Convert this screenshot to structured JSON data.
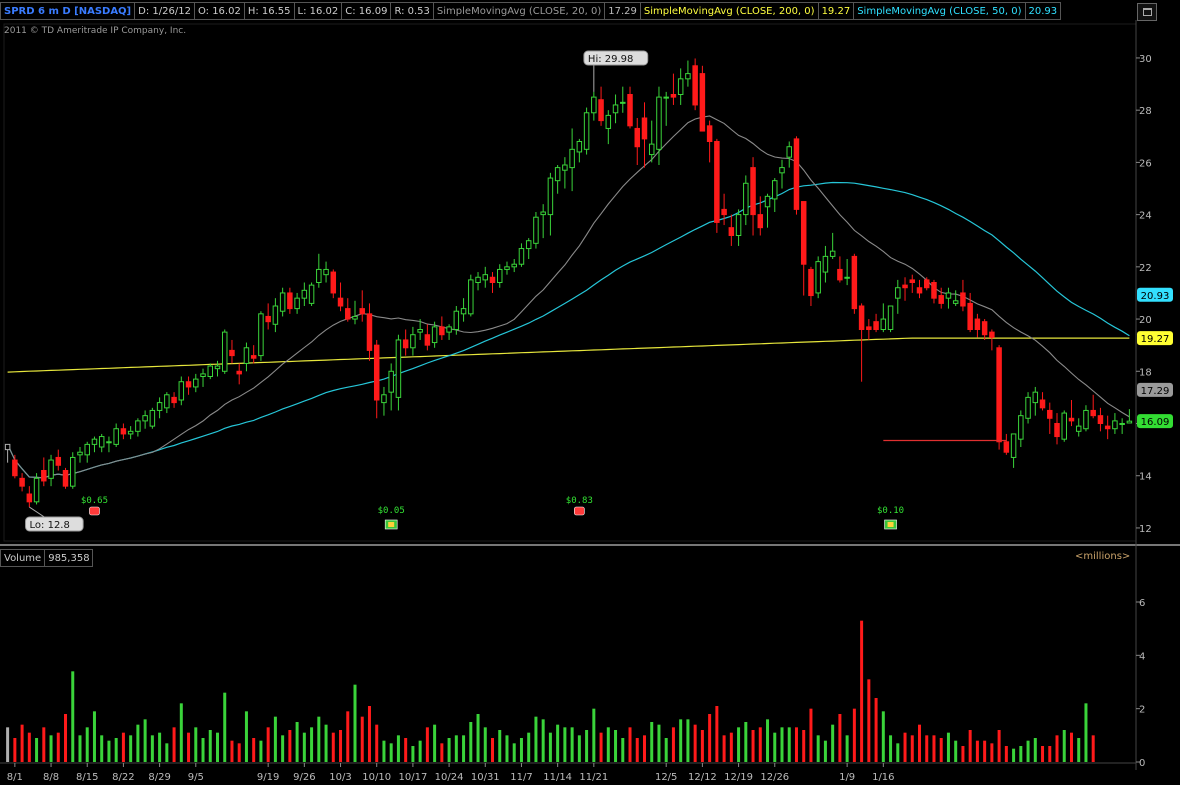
{
  "header": {
    "symbol": "SPRD 6 m D [NASDAQ]",
    "date": "D: 1/26/12",
    "open": "O: 16.02",
    "high": "H: 16.55",
    "low": "L: 16.02",
    "close": "C: 16.09",
    "range": "R: 0.53",
    "sma20_label": "SimpleMovingAvg (CLOSE, 20, 0)",
    "sma20_value": "17.29",
    "sma200_label": "SimpleMovingAvg (CLOSE, 200, 0)",
    "sma200_value": "19.27",
    "sma50_label": "SimpleMovingAvg (CLOSE, 50, 0)",
    "sma50_value": "20.93"
  },
  "copyright": "2011 © TD Ameritrade IP Company, Inc.",
  "volume_panel": {
    "label": "Volume",
    "value": "985,358",
    "unit": "<millions>"
  },
  "colors": {
    "up": "#3ad43a",
    "down": "#ff1a1a",
    "sma20": "#8a8a8a",
    "sma50": "#26c6d8",
    "sma200": "#e6e63c",
    "grid": "#2a2a2a",
    "axis_text": "#bbbbbb",
    "flat": "#b0b0b0"
  },
  "chart_data": [
    {
      "type": "candlestick",
      "title": "SPRD 6 m D [NASDAQ]",
      "ylim": [
        11.5,
        31.3
      ],
      "y_ticks": [
        "12",
        "14",
        "16",
        "18",
        "20",
        "22",
        "24",
        "26",
        "28",
        "30"
      ],
      "x_tick_labels": [
        "8/1",
        "8/8",
        "8/15",
        "8/22",
        "8/29",
        "9/5",
        "9/19",
        "9/26",
        "10/3",
        "10/10",
        "10/17",
        "10/24",
        "10/31",
        "11/7",
        "11/14",
        "11/21",
        "12/5",
        "12/12",
        "12/19",
        "12/26",
        "1/9",
        "1/16"
      ],
      "x_tick_positions": [
        1,
        6,
        11,
        16,
        21,
        26,
        36,
        41,
        46,
        51,
        56,
        61,
        66,
        71,
        76,
        81,
        91,
        96,
        101,
        106,
        116,
        121
      ],
      "hi_label": "Hi: 29.98",
      "lo_label": "Lo: 12.8",
      "hi_index": 81,
      "lo_index": 3,
      "sma_value_labels": {
        "sma50": "20.93",
        "sma200": "19.27",
        "sma20": "17.29",
        "last": "16.09"
      },
      "candles": [
        [
          15.0,
          15.2,
          14.5,
          15.2
        ],
        [
          14.6,
          14.8,
          13.9,
          14.0
        ],
        [
          13.9,
          14.1,
          13.4,
          13.6
        ],
        [
          13.3,
          13.6,
          12.8,
          13.0
        ],
        [
          13.0,
          14.1,
          12.9,
          13.9
        ],
        [
          14.2,
          14.7,
          13.6,
          13.8
        ],
        [
          13.9,
          14.8,
          13.6,
          14.6
        ],
        [
          14.7,
          15.0,
          14.2,
          14.4
        ],
        [
          14.2,
          14.3,
          13.5,
          13.6
        ],
        [
          13.6,
          14.9,
          13.5,
          14.7
        ],
        [
          14.8,
          15.1,
          14.5,
          14.9
        ],
        [
          14.8,
          15.3,
          14.5,
          15.2
        ],
        [
          15.2,
          15.5,
          14.9,
          15.4
        ],
        [
          15.1,
          15.6,
          14.9,
          15.5
        ],
        [
          15.3,
          15.5,
          14.9,
          15.3
        ],
        [
          15.2,
          16.0,
          15.1,
          15.8
        ],
        [
          15.8,
          16.0,
          15.4,
          15.6
        ],
        [
          15.6,
          15.9,
          15.4,
          15.7
        ],
        [
          15.7,
          16.2,
          15.5,
          16.1
        ],
        [
          16.1,
          16.5,
          15.8,
          16.3
        ],
        [
          15.9,
          16.6,
          15.8,
          16.5
        ],
        [
          16.5,
          17.0,
          16.2,
          16.8
        ],
        [
          16.6,
          17.2,
          16.4,
          17.1
        ],
        [
          17.0,
          17.2,
          16.6,
          16.8
        ],
        [
          16.9,
          17.8,
          16.7,
          17.6
        ],
        [
          17.6,
          17.8,
          17.1,
          17.4
        ],
        [
          17.4,
          17.9,
          17.2,
          17.7
        ],
        [
          17.8,
          18.1,
          17.4,
          17.9
        ],
        [
          17.8,
          18.3,
          17.7,
          18.2
        ],
        [
          18.1,
          18.4,
          17.8,
          18.2
        ],
        [
          18.0,
          19.6,
          17.9,
          19.5
        ],
        [
          18.8,
          19.2,
          18.3,
          18.6
        ],
        [
          18.0,
          18.3,
          17.5,
          17.9
        ],
        [
          18.3,
          19.1,
          18.0,
          18.9
        ],
        [
          18.6,
          19.0,
          18.3,
          18.5
        ],
        [
          18.6,
          20.3,
          18.4,
          20.2
        ],
        [
          20.1,
          20.6,
          19.6,
          19.9
        ],
        [
          19.8,
          20.8,
          19.5,
          20.5
        ],
        [
          20.3,
          21.2,
          20.1,
          21.0
        ],
        [
          21.0,
          21.2,
          20.2,
          20.4
        ],
        [
          20.4,
          21.0,
          20.2,
          20.8
        ],
        [
          20.8,
          21.4,
          20.5,
          21.1
        ],
        [
          20.6,
          21.4,
          20.5,
          21.3
        ],
        [
          21.4,
          22.5,
          21.2,
          21.9
        ],
        [
          21.7,
          22.2,
          21.4,
          21.9
        ],
        [
          21.8,
          21.9,
          20.8,
          21.0
        ],
        [
          20.8,
          21.4,
          20.3,
          20.5
        ],
        [
          20.4,
          20.8,
          19.9,
          20.0
        ],
        [
          20.0,
          20.7,
          19.8,
          20.1
        ],
        [
          20.4,
          21.1,
          19.9,
          20.2
        ],
        [
          20.2,
          20.6,
          18.4,
          18.8
        ],
        [
          19.0,
          19.2,
          16.2,
          16.9
        ],
        [
          16.8,
          17.4,
          16.3,
          17.1
        ],
        [
          17.2,
          18.3,
          16.5,
          18.0
        ],
        [
          17.0,
          19.4,
          16.5,
          19.2
        ],
        [
          19.2,
          19.6,
          18.6,
          18.9
        ],
        [
          18.9,
          19.7,
          18.6,
          19.4
        ],
        [
          19.5,
          20.0,
          19.2,
          19.6
        ],
        [
          19.4,
          19.8,
          18.8,
          19.0
        ],
        [
          19.1,
          19.9,
          18.9,
          19.7
        ],
        [
          19.7,
          20.1,
          19.2,
          19.4
        ],
        [
          19.5,
          19.8,
          19.2,
          19.7
        ],
        [
          19.6,
          20.5,
          19.4,
          20.3
        ],
        [
          20.2,
          20.8,
          19.9,
          20.4
        ],
        [
          20.2,
          21.7,
          20.1,
          21.5
        ],
        [
          21.4,
          21.8,
          21.1,
          21.6
        ],
        [
          21.5,
          22.0,
          21.2,
          21.7
        ],
        [
          21.6,
          21.8,
          21.0,
          21.4
        ],
        [
          21.4,
          22.1,
          21.2,
          21.9
        ],
        [
          21.9,
          22.2,
          21.7,
          22.0
        ],
        [
          22.0,
          22.3,
          21.8,
          22.1
        ],
        [
          22.1,
          22.9,
          22.0,
          22.7
        ],
        [
          22.7,
          23.1,
          22.3,
          23.0
        ],
        [
          22.9,
          24.1,
          22.7,
          23.9
        ],
        [
          24.0,
          24.4,
          23.1,
          24.1
        ],
        [
          24.0,
          25.6,
          23.2,
          25.4
        ],
        [
          25.3,
          25.9,
          24.8,
          25.8
        ],
        [
          25.7,
          26.2,
          25.0,
          25.9
        ],
        [
          25.8,
          27.3,
          24.9,
          26.5
        ],
        [
          26.4,
          26.9,
          26.0,
          26.8
        ],
        [
          26.5,
          28.1,
          26.3,
          27.9
        ],
        [
          27.9,
          28.7,
          27.6,
          28.5
        ],
        [
          28.4,
          28.9,
          27.4,
          27.6
        ],
        [
          27.3,
          28.0,
          26.7,
          27.8
        ],
        [
          27.9,
          28.6,
          27.5,
          28.2
        ],
        [
          28.3,
          28.9,
          27.9,
          28.3
        ],
        [
          28.6,
          28.9,
          27.3,
          27.4
        ],
        [
          27.3,
          27.7,
          25.9,
          26.6
        ],
        [
          27.7,
          28.3,
          25.8,
          26.9
        ],
        [
          26.3,
          27.6,
          26.0,
          26.7
        ],
        [
          26.5,
          28.9,
          25.9,
          28.5
        ],
        [
          28.5,
          28.7,
          27.4,
          28.5
        ],
        [
          28.6,
          29.4,
          28.2,
          28.5
        ],
        [
          28.6,
          29.6,
          28.2,
          29.2
        ],
        [
          29.2,
          29.9,
          28.9,
          29.4
        ],
        [
          29.7,
          29.98,
          28.0,
          28.2
        ],
        [
          29.4,
          29.7,
          28.1,
          27.2
        ],
        [
          27.4,
          27.6,
          26.0,
          26.8
        ],
        [
          26.8,
          26.9,
          23.3,
          23.7
        ],
        [
          24.2,
          24.8,
          23.6,
          24.0
        ],
        [
          23.5,
          24.0,
          22.8,
          23.2
        ],
        [
          23.2,
          24.2,
          22.8,
          24.0
        ],
        [
          24.0,
          25.5,
          23.6,
          25.2
        ],
        [
          25.8,
          26.2,
          23.2,
          24.0
        ],
        [
          24.0,
          24.7,
          23.2,
          23.5
        ],
        [
          24.3,
          24.8,
          23.5,
          24.7
        ],
        [
          24.6,
          25.4,
          24.1,
          25.3
        ],
        [
          25.6,
          26.1,
          25.0,
          25.8
        ],
        [
          26.2,
          26.8,
          25.8,
          26.6
        ],
        [
          26.9,
          27.0,
          24.0,
          24.2
        ],
        [
          24.5,
          24.5,
          20.9,
          22.1
        ],
        [
          21.9,
          22.0,
          20.5,
          20.9
        ],
        [
          21.0,
          22.4,
          20.8,
          22.2
        ],
        [
          21.8,
          22.8,
          21.4,
          22.4
        ],
        [
          22.4,
          23.3,
          22.3,
          22.6
        ],
        [
          21.9,
          22.4,
          21.4,
          21.5
        ],
        [
          21.6,
          22.3,
          21.3,
          21.6
        ],
        [
          22.4,
          22.5,
          20.2,
          20.4
        ],
        [
          20.5,
          20.6,
          17.6,
          19.6
        ],
        [
          19.7,
          20.0,
          19.2,
          19.6
        ],
        [
          19.9,
          20.2,
          19.5,
          19.6
        ],
        [
          19.6,
          20.6,
          19.5,
          20.0
        ],
        [
          19.6,
          20.5,
          19.5,
          20.5
        ],
        [
          20.8,
          21.5,
          20.2,
          21.2
        ],
        [
          21.3,
          21.6,
          20.7,
          21.2
        ],
        [
          21.5,
          21.7,
          21.0,
          21.4
        ],
        [
          21.2,
          21.5,
          20.8,
          21.0
        ],
        [
          21.5,
          21.6,
          21.1,
          21.2
        ],
        [
          21.4,
          21.5,
          20.6,
          20.8
        ],
        [
          20.9,
          21.2,
          20.4,
          20.6
        ],
        [
          20.8,
          21.2,
          20.4,
          21.0
        ],
        [
          20.6,
          21.1,
          20.5,
          20.7
        ],
        [
          21.0,
          21.5,
          20.3,
          20.5
        ],
        [
          20.6,
          21.0,
          19.5,
          19.6
        ],
        [
          20.0,
          20.2,
          19.3,
          19.6
        ],
        [
          19.9,
          20.0,
          19.2,
          19.4
        ],
        [
          19.5,
          19.6,
          18.8,
          19.3
        ],
        [
          18.9,
          19.0,
          15.0,
          15.3
        ],
        [
          15.3,
          15.6,
          14.8,
          14.9
        ],
        [
          14.7,
          15.6,
          14.3,
          15.6
        ],
        [
          15.4,
          16.5,
          15.1,
          16.3
        ],
        [
          16.2,
          17.2,
          16.0,
          17.0
        ],
        [
          16.8,
          17.4,
          16.3,
          17.2
        ],
        [
          16.9,
          17.2,
          16.5,
          16.6
        ],
        [
          16.5,
          16.8,
          15.6,
          16.2
        ],
        [
          16.0,
          16.4,
          15.2,
          15.5
        ],
        [
          15.4,
          16.5,
          15.3,
          16.4
        ],
        [
          16.2,
          16.9,
          15.9,
          16.1
        ],
        [
          15.7,
          16.2,
          15.5,
          15.9
        ],
        [
          15.8,
          16.7,
          15.7,
          16.5
        ],
        [
          16.5,
          17.1,
          16.2,
          16.3
        ],
        [
          16.3,
          16.6,
          15.7,
          16.0
        ],
        [
          15.9,
          16.3,
          15.4,
          15.8
        ],
        [
          15.8,
          16.4,
          15.6,
          16.1
        ],
        [
          16.0,
          16.2,
          15.6,
          16.0
        ],
        [
          16.02,
          16.55,
          16.02,
          16.09
        ]
      ],
      "dividends": [
        {
          "label": "$0.65",
          "index": 12,
          "icon": "phone-icon"
        },
        {
          "label": "$0.05",
          "index": 53,
          "icon": "dividend-icon"
        },
        {
          "label": "$0.83",
          "index": 79,
          "icon": "phone-icon"
        },
        {
          "label": "$0.10",
          "index": 122,
          "icon": "dividend-icon"
        }
      ],
      "support_line": {
        "value": 15.35,
        "from_index": 121,
        "to_index": 138
      }
    },
    {
      "type": "bar",
      "title": "Volume",
      "ylabel": "millions",
      "ylim": [
        0,
        7.2
      ],
      "y_ticks": [
        "0",
        "2",
        "4",
        "6"
      ],
      "values": [
        1.3,
        0.9,
        1.4,
        1.1,
        0.9,
        1.3,
        1.0,
        1.1,
        1.8,
        3.4,
        1.0,
        1.3,
        1.9,
        1.0,
        0.8,
        0.9,
        1.1,
        1.0,
        1.4,
        1.6,
        1.0,
        1.1,
        0.7,
        1.3,
        2.2,
        1.1,
        1.3,
        0.9,
        1.2,
        1.1,
        2.6,
        0.8,
        0.7,
        1.9,
        0.9,
        0.8,
        1.3,
        1.7,
        1.0,
        1.2,
        1.5,
        1.1,
        1.3,
        1.7,
        1.4,
        1.1,
        1.2,
        1.9,
        2.9,
        1.7,
        2.1,
        1.4,
        0.8,
        0.7,
        1.0,
        0.9,
        0.6,
        0.8,
        1.3,
        1.4,
        0.7,
        0.9,
        1.0,
        1.0,
        1.5,
        1.8,
        1.3,
        0.9,
        1.2,
        1.0,
        0.7,
        0.9,
        1.1,
        1.7,
        1.6,
        1.1,
        1.4,
        1.3,
        1.3,
        1.0,
        1.2,
        2.0,
        1.1,
        1.3,
        1.2,
        0.9,
        1.3,
        0.9,
        1.0,
        1.5,
        1.4,
        0.9,
        1.3,
        1.6,
        1.6,
        1.4,
        1.2,
        1.8,
        2.1,
        1.0,
        1.1,
        1.3,
        1.5,
        1.2,
        1.3,
        1.6,
        1.1,
        1.3,
        1.3,
        1.3,
        1.2,
        2.0,
        1.0,
        0.8,
        1.4,
        1.8,
        1.0,
        2.0,
        5.3,
        3.1,
        2.4,
        1.9,
        1.0,
        0.7,
        1.1,
        1.0,
        1.4,
        1.0,
        1.0,
        0.9,
        1.1,
        0.8,
        0.6,
        1.2,
        0.8,
        0.8,
        0.7,
        1.2,
        0.6,
        0.5,
        0.6,
        0.8,
        0.9,
        0.6,
        0.6,
        1.0,
        1.2,
        1.1,
        0.9,
        2.2,
        1.0
      ]
    }
  ]
}
